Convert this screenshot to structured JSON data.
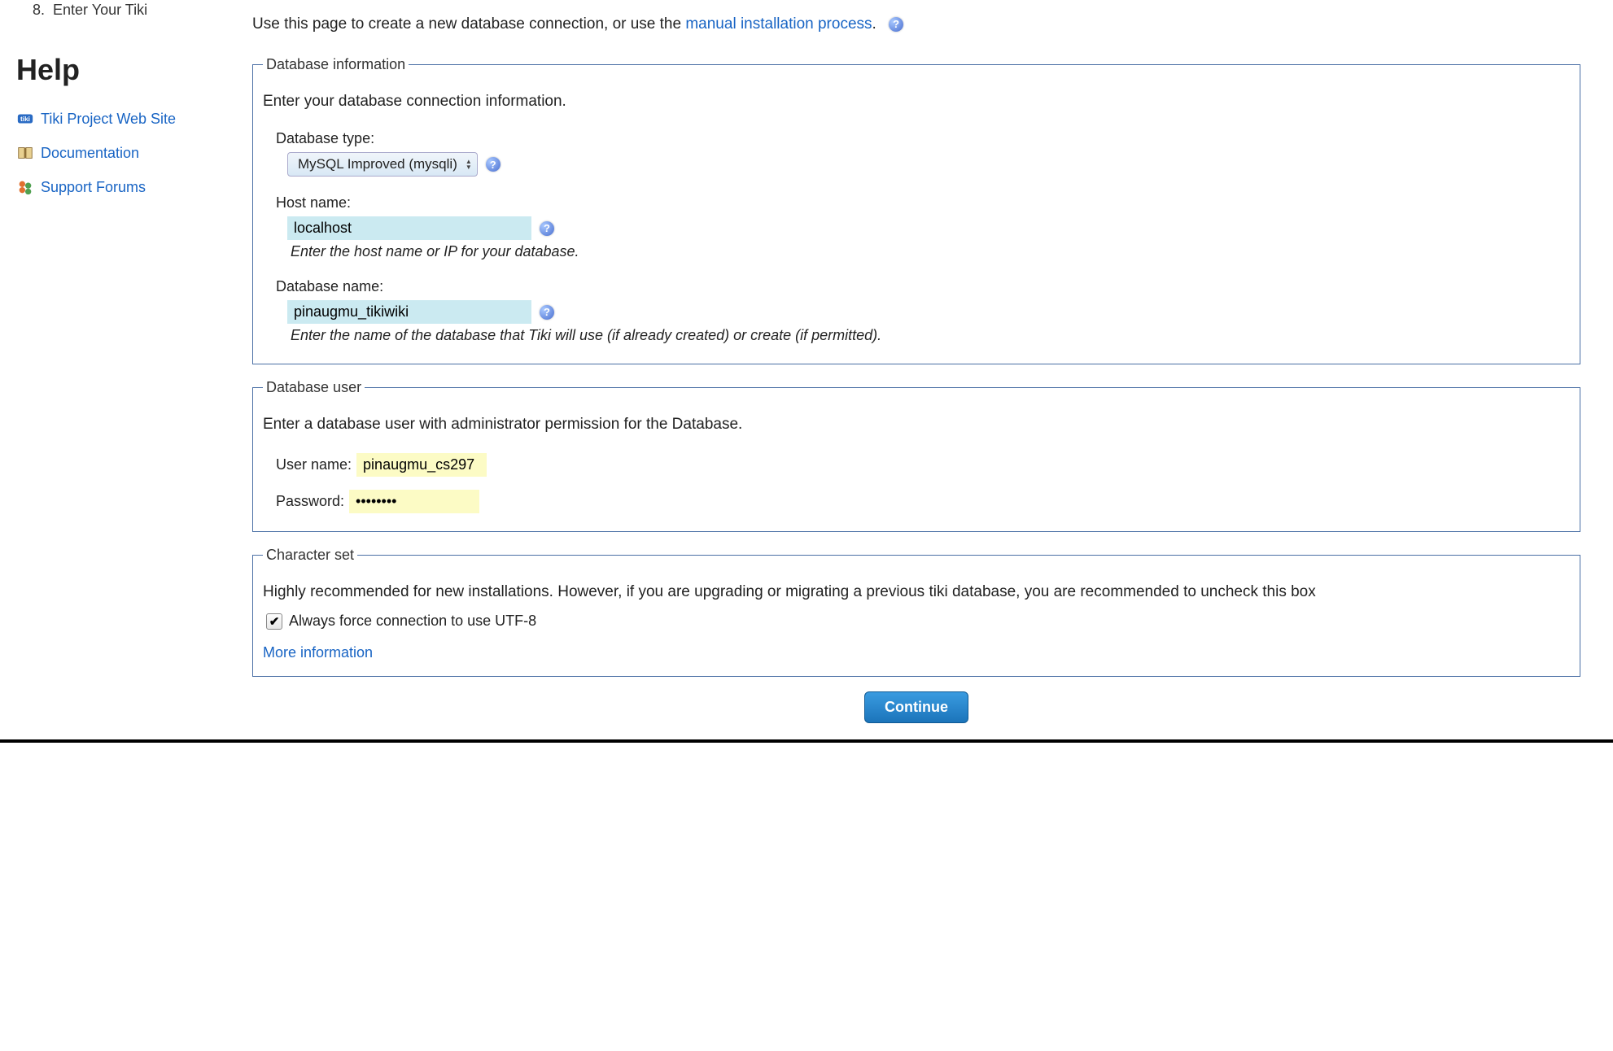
{
  "sidebar": {
    "nav_item": {
      "num": "8.",
      "label": "Enter Your Tiki"
    },
    "help_heading": "Help",
    "links": [
      {
        "label": "Tiki Project Web Site",
        "icon": "tiki-icon"
      },
      {
        "label": "Documentation",
        "icon": "book-icon"
      },
      {
        "label": "Support Forums",
        "icon": "people-icon"
      }
    ]
  },
  "intro": {
    "prefix": "Use this page to create a new database connection, or use the ",
    "link": "manual installation process",
    "suffix": "."
  },
  "db_info": {
    "legend": "Database information",
    "desc": "Enter your database connection information.",
    "type_label": "Database type:",
    "type_value": "MySQL Improved (mysqli)",
    "host_label": "Host name:",
    "host_value": "localhost",
    "host_hint": "Enter the host name or IP for your database.",
    "name_label": "Database name:",
    "name_value": "pinaugmu_tikiwiki",
    "name_hint": "Enter the name of the database that Tiki will use (if already created) or create (if permitted)."
  },
  "db_user": {
    "legend": "Database user",
    "desc": "Enter a database user with administrator permission for the Database.",
    "user_label": "User name:",
    "user_value": "pinaugmu_cs297",
    "pass_label": "Password:",
    "pass_value": "••••••••"
  },
  "charset": {
    "legend": "Character set",
    "desc": "Highly recommended for new installations. However, if you are upgrading or migrating a previous tiki database, you are recommended to uncheck this box",
    "checkbox_label": "Always force connection to use UTF-8",
    "checkbox_checked": true,
    "more_link": "More information"
  },
  "continue_label": "Continue"
}
